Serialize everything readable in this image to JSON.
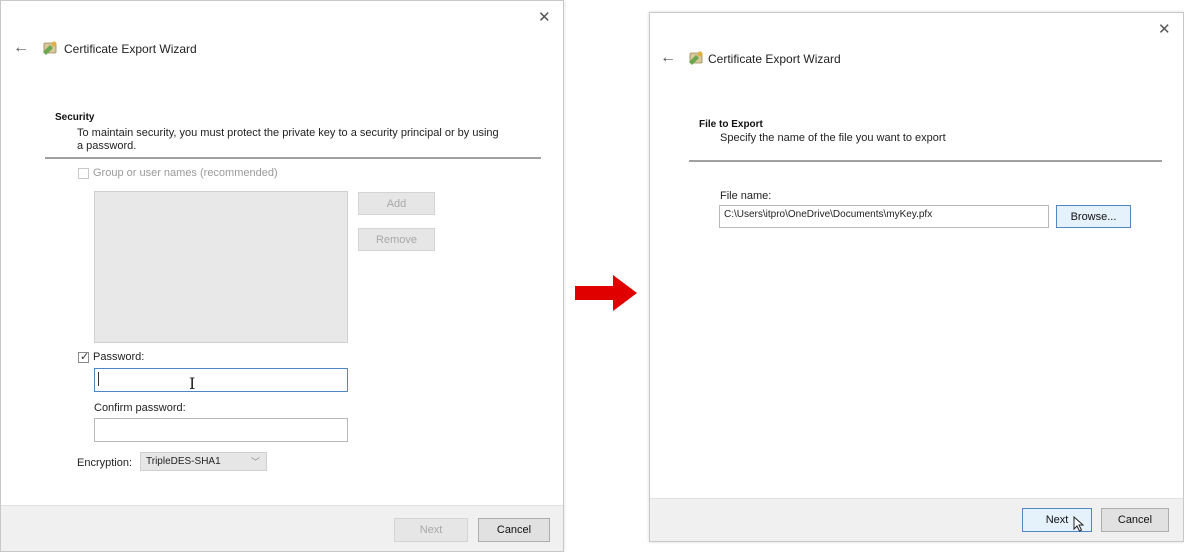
{
  "left_dialog": {
    "title": "Certificate Export Wizard",
    "section_title": "Security",
    "section_desc": "To maintain security, you must protect the private key to a security principal or by using a password.",
    "group_checkbox_label": "Group or user names (recommended)",
    "group_checkbox_checked": false,
    "add_label": "Add",
    "remove_label": "Remove",
    "password_checkbox_label": "Password:",
    "password_checkbox_checked": true,
    "password_value": "",
    "confirm_label": "Confirm password:",
    "confirm_value": "",
    "encryption_label": "Encryption:",
    "encryption_value": "TripleDES-SHA1",
    "next_label": "Next",
    "cancel_label": "Cancel"
  },
  "right_dialog": {
    "title": "Certificate Export Wizard",
    "section_title": "File to Export",
    "section_desc": "Specify the name of the file you want to export",
    "file_name_label": "File name:",
    "file_name_value": "C:\\Users\\itpro\\OneDrive\\Documents\\myKey.pfx",
    "browse_label": "Browse...",
    "next_label": "Next",
    "cancel_label": "Cancel"
  },
  "icons": {
    "close": "close-icon",
    "back": "back-arrow-icon",
    "wizard": "certificate-wizard-icon",
    "transition": "red-right-arrow-icon",
    "cursor": "mouse-pointer-icon",
    "text_cursor": "text-cursor-icon"
  },
  "colors": {
    "arrow": "#e00000",
    "focus_border": "#4f86c6",
    "footer": "#f0f0f0"
  }
}
